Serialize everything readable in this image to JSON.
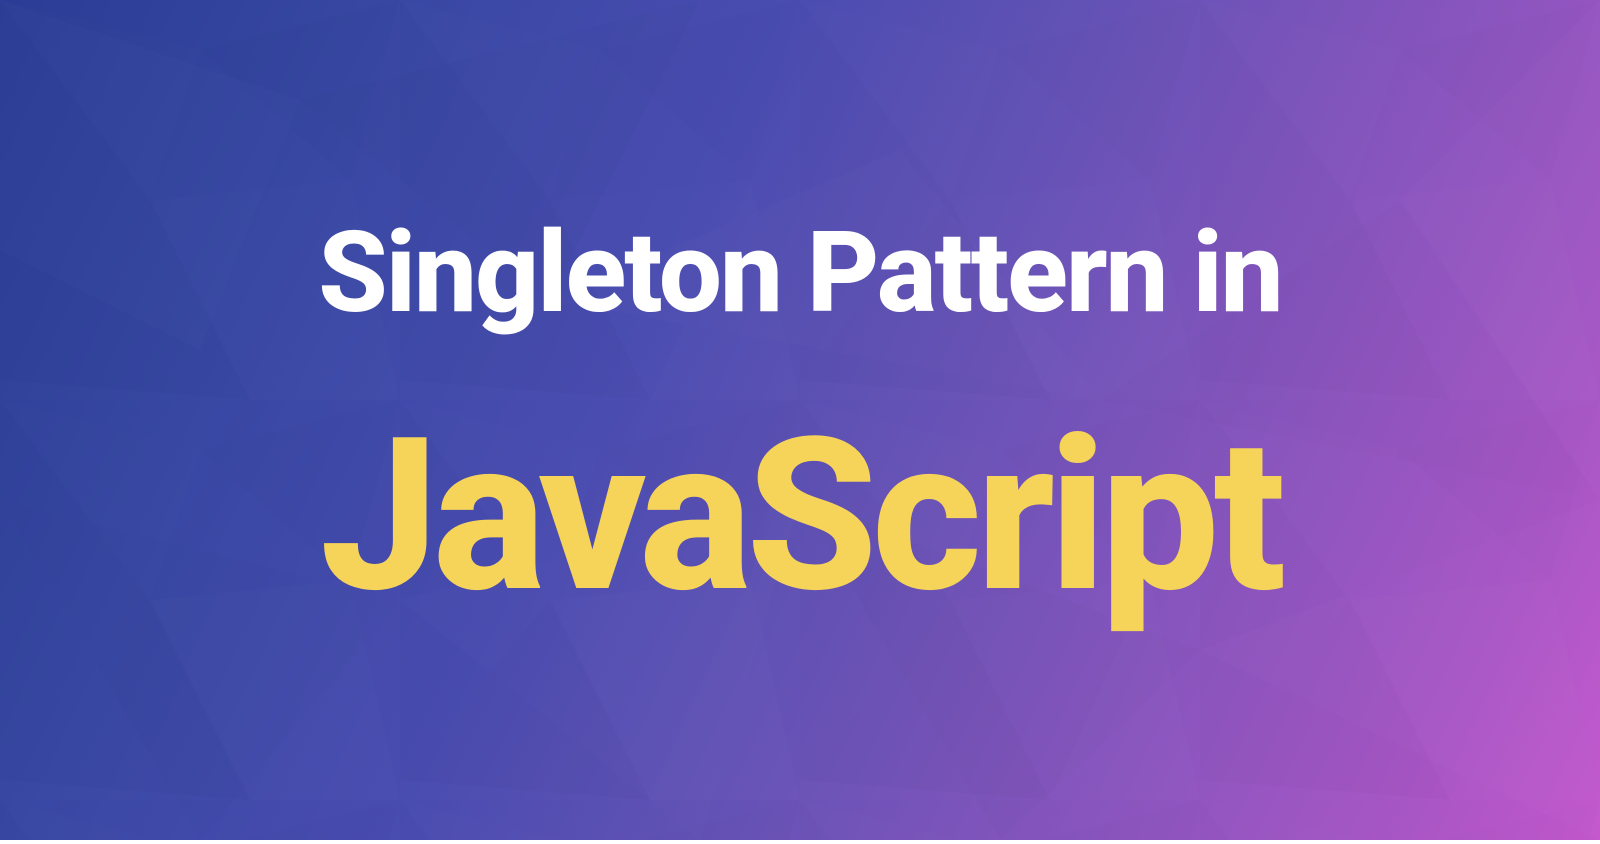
{
  "hero": {
    "line_one": "Singleton Pattern in",
    "line_two": "JavaScript"
  },
  "colors": {
    "gradient_start": "#2a3c95",
    "gradient_end": "#c357cc",
    "text_primary": "#ffffff",
    "text_accent": "#f6d359"
  }
}
